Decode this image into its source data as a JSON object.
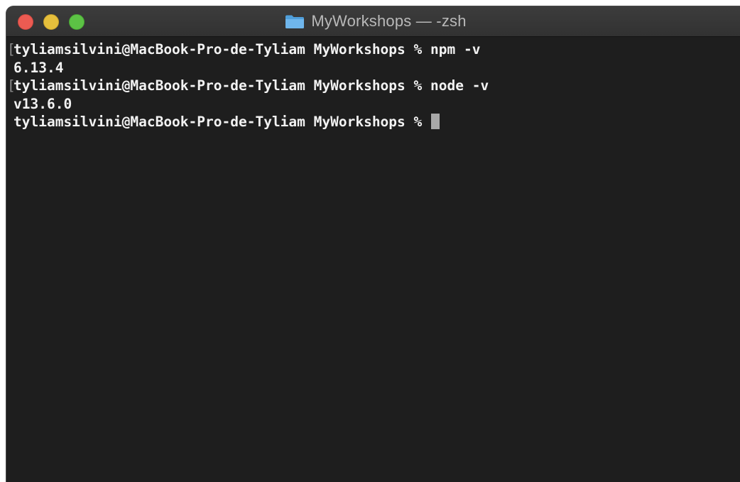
{
  "window": {
    "title": "MyWorkshops — -zsh",
    "colors": {
      "close": "#ec5b52",
      "minimize": "#e6bf3c",
      "zoom": "#5cc245",
      "folder": "#6fb6ec",
      "background": "#1e1e1e",
      "text": "#f2f2f2"
    }
  },
  "terminal": {
    "lines": [
      {
        "mark": "[",
        "text": "tyliamsilvini@MacBook-Pro-de-Tyliam MyWorkshops % npm -v"
      },
      {
        "mark": "",
        "text": "6.13.4"
      },
      {
        "mark": "[",
        "text": "tyliamsilvini@MacBook-Pro-de-Tyliam MyWorkshops % node -v"
      },
      {
        "mark": "",
        "text": "v13.6.0"
      },
      {
        "mark": "",
        "text": "tyliamsilvini@MacBook-Pro-de-Tyliam MyWorkshops % "
      }
    ]
  }
}
